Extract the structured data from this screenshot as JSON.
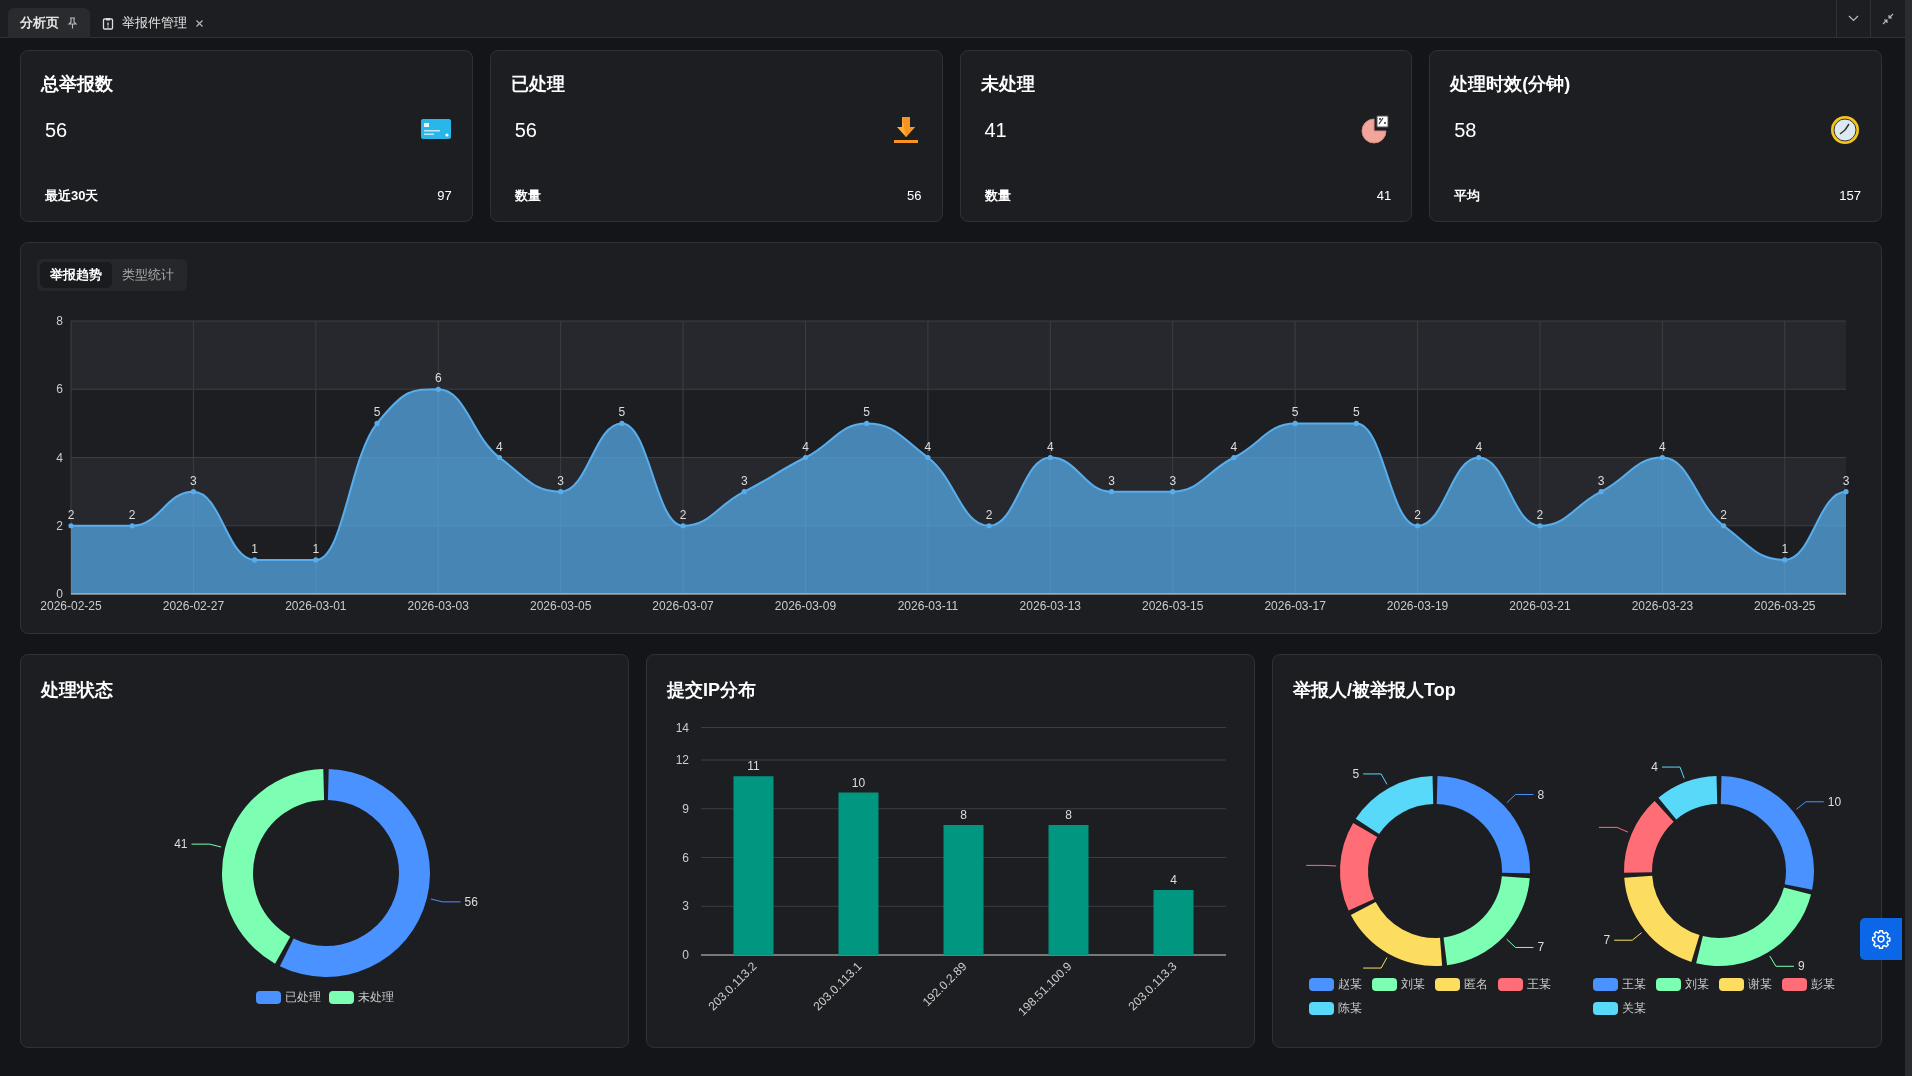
{
  "tabs": [
    {
      "label": "分析页",
      "selected": true,
      "pinned": true
    },
    {
      "label": "举报件管理",
      "selected": false,
      "closable": true
    }
  ],
  "stat_cards": [
    {
      "title": "总举报数",
      "value": "56",
      "footer_label": "最近30天",
      "footer_value": "97"
    },
    {
      "title": "已处理",
      "value": "56",
      "footer_label": "数量",
      "footer_value": "56"
    },
    {
      "title": "未处理",
      "value": "41",
      "footer_label": "数量",
      "footer_value": "41"
    },
    {
      "title": "处理时效(分钟)",
      "value": "58",
      "footer_label": "平均",
      "footer_value": "157"
    }
  ],
  "trend_panel": {
    "tabs": [
      {
        "label": "举报趋势",
        "selected": true
      },
      {
        "label": "类型统计",
        "selected": false
      }
    ],
    "chart_data": {
      "type": "area",
      "categories": [
        "2026-02-25",
        null,
        "2026-02-27",
        null,
        "2026-03-01",
        null,
        "2026-03-03",
        null,
        "2026-03-05",
        null,
        "2026-03-07",
        null,
        "2026-03-09",
        null,
        "2026-03-11",
        null,
        "2026-03-13",
        null,
        "2026-03-15",
        null,
        "2026-03-17",
        null,
        "2026-03-19",
        null,
        "2026-03-21",
        null,
        "2026-03-23",
        null,
        "2026-03-25",
        null
      ],
      "ylim": [
        0,
        8
      ],
      "yticks": [
        0,
        2,
        4,
        6,
        8
      ],
      "grid": true,
      "data_labels": true,
      "series": [
        {
          "color": "#58aeed",
          "values": [
            2,
            2,
            3,
            1,
            1,
            5,
            6,
            4,
            3,
            5,
            2,
            3,
            4,
            5,
            4,
            2,
            4,
            3,
            3,
            4,
            5,
            5,
            2,
            4,
            2,
            3,
            4,
            2,
            1,
            3
          ]
        }
      ]
    }
  },
  "status_panel": {
    "title": "处理状态",
    "chart_data": {
      "type": "donut",
      "categories": [
        "已处理",
        "未处理"
      ],
      "values": [
        56,
        41
      ],
      "data_labels": true
    },
    "legend": [
      {
        "color": "#4992ff"
      },
      {
        "color": "#7cffb2"
      }
    ]
  },
  "ip_panel": {
    "title": "提交IP分布",
    "chart_data": {
      "type": "bar",
      "categories": [
        "203.0.113.2",
        "203.0.113.1",
        "192.0.2.89",
        "198.51.100.9",
        "203.0.113.3"
      ],
      "ylim": [
        0,
        14
      ],
      "yticks": [
        0,
        3,
        6,
        9,
        12,
        14
      ],
      "grid": true,
      "data_labels": true,
      "series": [
        {
          "color": "#019680",
          "values": [
            11,
            10,
            8,
            8,
            4
          ]
        }
      ]
    }
  },
  "top_panel": {
    "title": "举报人/被举报人Top",
    "charts": [
      {
        "chart_data": {
          "type": "donut",
          "categories": [
            "赵某",
            "刘某",
            "匿名",
            "王某",
            "陈某"
          ],
          "values": [
            8,
            7,
            6,
            5,
            5
          ],
          "value_labels": [
            "8",
            "7",
            null,
            null,
            "5"
          ]
        },
        "legend": [
          {
            "color": "#4992ff"
          },
          {
            "color": "#7cffb2"
          },
          {
            "color": "#fddd60"
          },
          {
            "color": "#ff6e76"
          },
          {
            "color": "#58d9f9"
          }
        ]
      },
      {
        "chart_data": {
          "type": "donut",
          "categories": [
            "王某",
            "刘某",
            "谢某",
            "彭某",
            "关某"
          ],
          "values": [
            10,
            9,
            7,
            5,
            4
          ],
          "value_labels": [
            "10",
            "9",
            "7",
            null,
            "4"
          ]
        },
        "legend": [
          {
            "color": "#4992ff"
          },
          {
            "color": "#7cffb2"
          },
          {
            "color": "#fddd60"
          },
          {
            "color": "#ff6e76"
          },
          {
            "color": "#58d9f9"
          }
        ]
      }
    ]
  }
}
